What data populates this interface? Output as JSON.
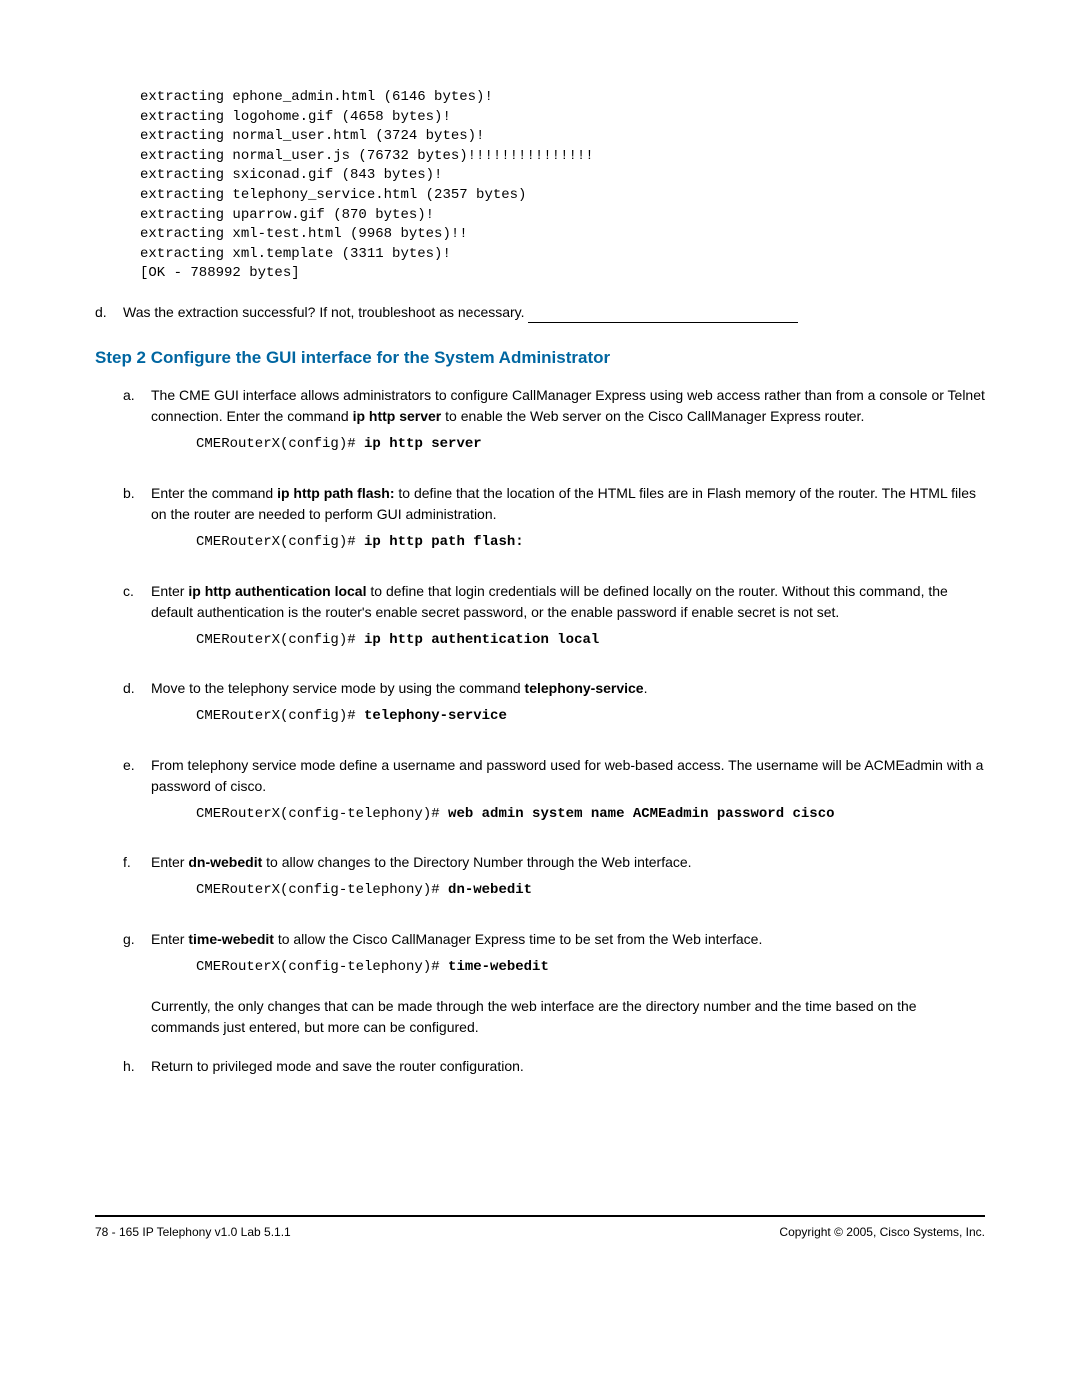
{
  "extraction": {
    "lines": [
      "extracting ephone_admin.html (6146 bytes)!",
      "extracting logohome.gif (4658 bytes)!",
      "extracting normal_user.html (3724 bytes)!",
      "extracting normal_user.js (76732 bytes)!!!!!!!!!!!!!!!",
      "extracting sxiconad.gif (843 bytes)!",
      "extracting telephony_service.html (2357 bytes)",
      "extracting uparrow.gif (870 bytes)!",
      "extracting xml-test.html (9968 bytes)!!",
      "extracting xml.template (3311 bytes)!",
      "[OK - 788992 bytes]"
    ]
  },
  "items": {
    "d1": {
      "letter": "d.",
      "text": "Was the extraction successful? If not, troubleshoot as necessary. "
    }
  },
  "step2": {
    "heading": "Step 2 Configure the GUI interface for the System Administrator",
    "a": {
      "letter": "a.",
      "text1": "The CME GUI interface allows administrators to configure CallManager Express using web access rather than from a console or Telnet connection. Enter the command ",
      "bold1": "ip http server",
      "text2": " to enable the Web server on the Cisco CallManager Express router.",
      "code_prefix": "CMERouterX(config)# ",
      "code_bold": "ip http server"
    },
    "b": {
      "letter": "b.",
      "text1": "Enter the command ",
      "bold1": "ip http path flash:",
      "text2": " to define that the location of the HTML files are in Flash memory of the router. The HTML files on the router are needed to perform GUI administration.",
      "code_prefix": "CMERouterX(config)# ",
      "code_bold": "ip http path flash:"
    },
    "c": {
      "letter": "c.",
      "text1": "Enter ",
      "bold1": "ip http authentication local",
      "text2": " to define that login credentials will be defined locally on the router. Without this command, the default authentication is the router's enable secret password, or the enable password if enable secret is not set.",
      "code_prefix": "CMERouterX(config)# ",
      "code_bold": "ip http authentication local"
    },
    "d": {
      "letter": "d.",
      "text1": "Move to the telephony service mode by using the command ",
      "bold1": "telephony-service",
      "text2": ".",
      "code_prefix": "CMERouterX(config)# ",
      "code_bold": "telephony-service"
    },
    "e": {
      "letter": "e.",
      "text1": "From telephony service mode define a username and password used for web-based access. The username will be ACMEadmin with a password of cisco.",
      "code_prefix": "CMERouterX(config-telephony)# ",
      "code_bold": "web admin system name ACMEadmin password cisco"
    },
    "f": {
      "letter": "f.",
      "text1": "Enter ",
      "bold1": "dn-webedit",
      "text2": " to allow changes to the Directory Number through the Web interface.",
      "code_prefix": "CMERouterX(config-telephony)# ",
      "code_bold": "dn-webedit"
    },
    "g": {
      "letter": "g.",
      "text1": "Enter ",
      "bold1": "time-webedit",
      "text2": " to allow the Cisco CallManager Express time to be set from the Web interface.",
      "code_prefix": "CMERouterX(config-telephony)# ",
      "code_bold": "time-webedit",
      "post": "Currently, the only changes that can be made through the web interface are the directory number and the time based on the commands just entered, but more can be configured."
    },
    "h": {
      "letter": "h.",
      "text1": "Return to privileged mode and save the router configuration."
    }
  },
  "footer": {
    "left": "78 - 165   IP Telephony v1.0   Lab 5.1.1",
    "right": "Copyright © 2005, Cisco Systems, Inc."
  }
}
